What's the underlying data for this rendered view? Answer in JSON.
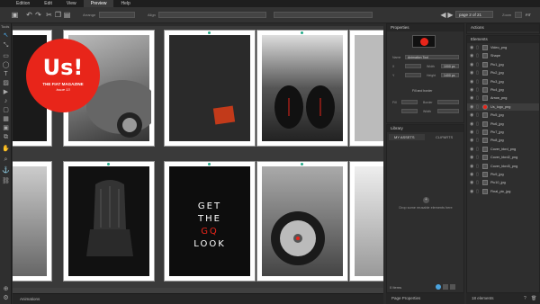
{
  "menu": {
    "items": [
      {
        "label": "Edition"
      },
      {
        "label": "Edit"
      },
      {
        "label": "View"
      },
      {
        "label": "Preview"
      },
      {
        "label": "Help"
      }
    ]
  },
  "toolbar": {
    "arrange_label": "Arrange",
    "align_label": "Align",
    "page_select": "page 2 of 21",
    "zoom_label": "Zoom",
    "fit_label": "FIT"
  },
  "tools": {
    "label": "Tools"
  },
  "canvas": {
    "cover": {
      "logo": "Us!",
      "subtitle": "THE FIAT MAGAZINE",
      "issue": "Issue 13"
    },
    "spread_text": {
      "line1": "GET",
      "line2": "THE",
      "line3": "GQ",
      "line4": "LOOK"
    }
  },
  "properties": {
    "title": "Properties",
    "name_label": "Name",
    "name_value": "Animation Tool",
    "x_label": "X",
    "y_label": "Y",
    "width_label": "Width",
    "height_label": "Height",
    "width_value": "1000 px",
    "height_value": "1400 px",
    "fill_border_label": "Fill and border",
    "fill_label": "Fill",
    "border_label": "Border",
    "width2_label": "Width"
  },
  "library": {
    "title": "Library",
    "tab_my_assets": "MY ASSETS",
    "tab_cliparts": "CLIPARTS",
    "drop_text": "Drop some reusable elements here",
    "count": "0 Items"
  },
  "actions": {
    "title": "Actions"
  },
  "elements": {
    "title": "Elements",
    "items": [
      {
        "name": "Video_png"
      },
      {
        "name": "Shape"
      },
      {
        "name": "Pic1_jpg"
      },
      {
        "name": "Pic2_jpg"
      },
      {
        "name": "Pic3_jpg"
      },
      {
        "name": "Pic4_jpg"
      },
      {
        "name": "Arrow_png"
      },
      {
        "name": "Us_logo_png"
      },
      {
        "name": "Pic5_jpg"
      },
      {
        "name": "Pic6_jpg"
      },
      {
        "name": "Pic7_jpg"
      },
      {
        "name": "Pic8_jpg"
      },
      {
        "name": "Cover_bkrd_png"
      },
      {
        "name": "Cover_bkrd2_png"
      },
      {
        "name": "Cover_bkrd3_png"
      },
      {
        "name": "Pic9_jpg"
      },
      {
        "name": "Pic10_jpg"
      },
      {
        "name": "Final_pic_jpg"
      }
    ],
    "count": "18 elements"
  },
  "bottom": {
    "animations": "Animations",
    "page_properties": "Page Properties"
  },
  "colors": {
    "accent_red": "#e8251a",
    "panel": "#2e2e2e"
  }
}
